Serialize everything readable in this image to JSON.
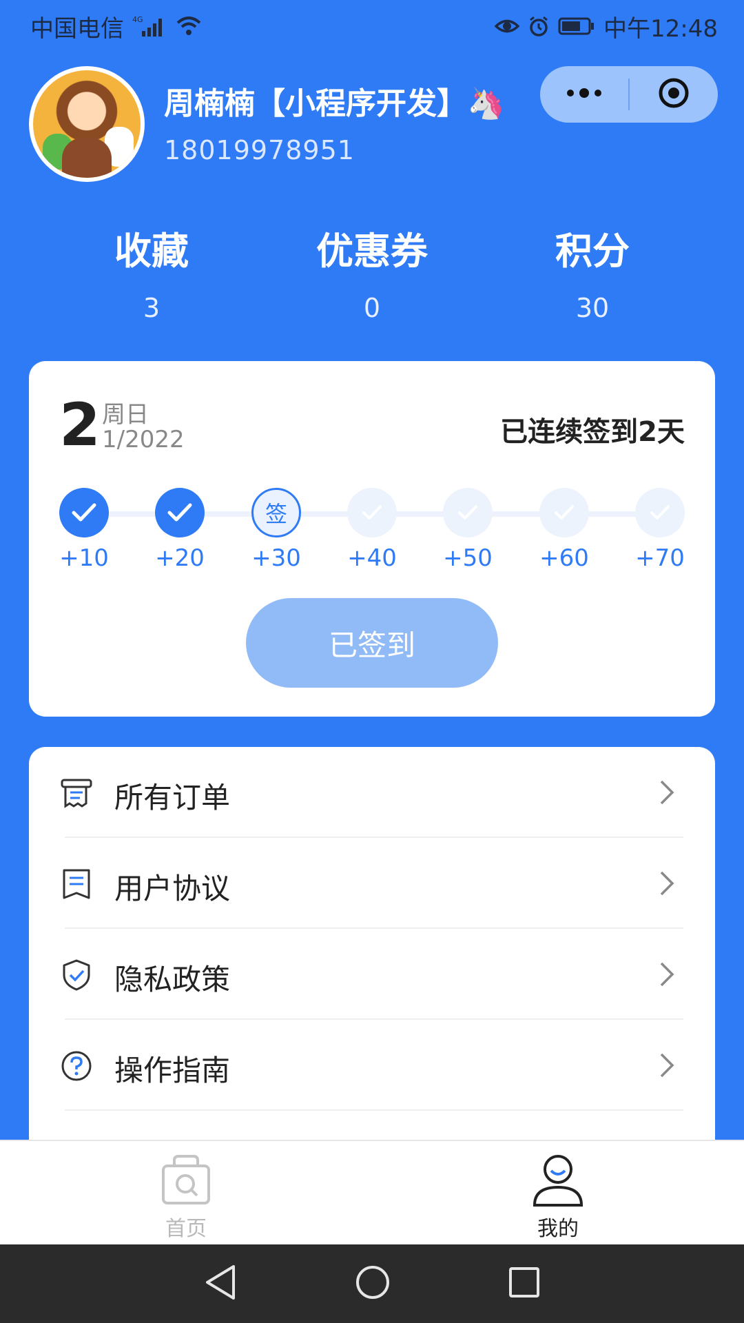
{
  "status_bar": {
    "carrier": "中国电信",
    "network": "4G",
    "time": "中午12:48"
  },
  "profile": {
    "name": "周楠楠【小程序开发】🦄",
    "phone": "18019978951"
  },
  "stats": [
    {
      "label": "收藏",
      "value": "3"
    },
    {
      "label": "优惠券",
      "value": "0"
    },
    {
      "label": "积分",
      "value": "30"
    }
  ],
  "checkin": {
    "day": "2",
    "weekday": "周日",
    "month_year": "1/2022",
    "streak": "已连续签到2天",
    "today_mark": "签",
    "days": [
      {
        "points": "+10",
        "state": "done"
      },
      {
        "points": "+20",
        "state": "done"
      },
      {
        "points": "+30",
        "state": "today"
      },
      {
        "points": "+40",
        "state": "future"
      },
      {
        "points": "+50",
        "state": "future"
      },
      {
        "points": "+60",
        "state": "future"
      },
      {
        "points": "+70",
        "state": "future"
      }
    ],
    "button_label": "已签到"
  },
  "menu": {
    "items": [
      {
        "label": "所有订单",
        "icon": "receipt-icon"
      },
      {
        "label": "用户协议",
        "icon": "document-icon"
      },
      {
        "label": "隐私政策",
        "icon": "shield-check-icon"
      },
      {
        "label": "操作指南",
        "icon": "question-icon"
      }
    ]
  },
  "tabbar": {
    "home_label": "首页",
    "mine_label": "我的"
  },
  "colors": {
    "primary": "#2f7bf6",
    "button_disabled": "#91bbf6"
  }
}
